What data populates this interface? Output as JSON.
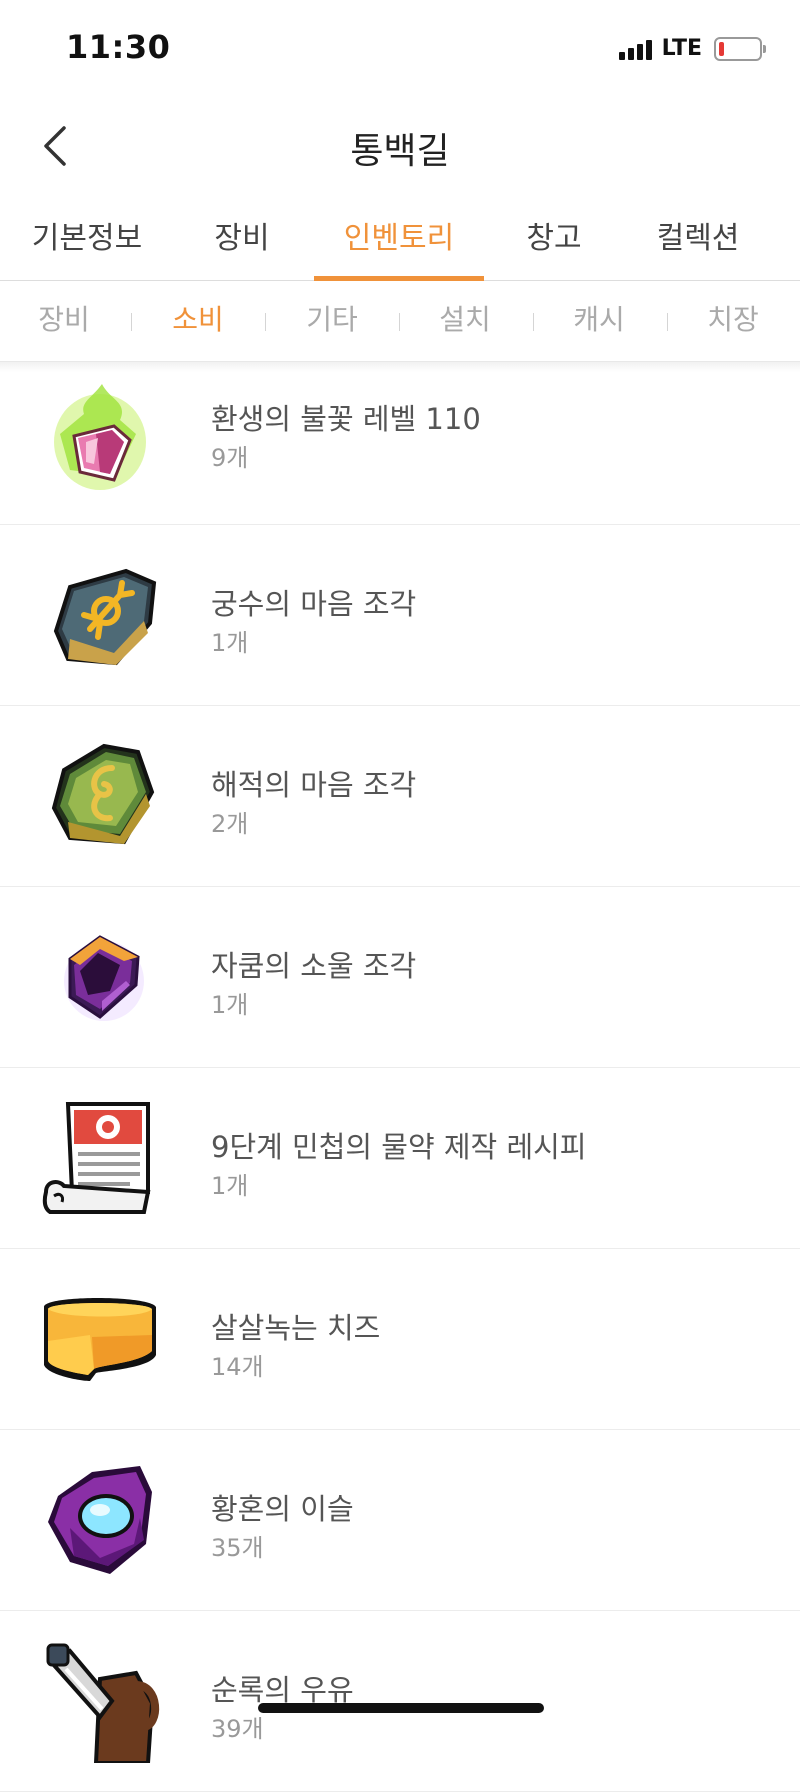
{
  "status_bar": {
    "time": "11:30",
    "network": "LTE"
  },
  "header": {
    "title": "통백길"
  },
  "main_tabs": [
    {
      "label": "기본정보"
    },
    {
      "label": "장비"
    },
    {
      "label": "인벤토리"
    },
    {
      "label": "창고"
    },
    {
      "label": "컬렉션"
    }
  ],
  "active_main_tab": "인벤토리",
  "sub_tabs": [
    {
      "label": "장비"
    },
    {
      "label": "소비"
    },
    {
      "label": "기타"
    },
    {
      "label": "설치"
    },
    {
      "label": "캐시"
    },
    {
      "label": "치장"
    }
  ],
  "active_sub_tab": "소비",
  "colors": {
    "accent": "#f0923a",
    "text": "#555555",
    "muted": "#999999"
  },
  "items": [
    {
      "name": "환생의 불꽃 레벨 110",
      "count": "9개",
      "icon": "rebirth-flame-icon"
    },
    {
      "name": "궁수의 마음 조각",
      "count": "1개",
      "icon": "bowman-heart-fragment-icon"
    },
    {
      "name": "해적의 마음 조각",
      "count": "2개",
      "icon": "pirate-heart-fragment-icon"
    },
    {
      "name": "자쿰의 소울 조각",
      "count": "1개",
      "icon": "zakum-soul-shard-icon"
    },
    {
      "name": "9단계 민첩의 물약 제작 레시피",
      "count": "1개",
      "icon": "recipe-scroll-icon"
    },
    {
      "name": "살살녹는 치즈",
      "count": "14개",
      "icon": "cheese-icon"
    },
    {
      "name": "황혼의 이슬",
      "count": "35개",
      "icon": "twilight-dew-icon"
    },
    {
      "name": "순록의 우유",
      "count": "39개",
      "icon": "reindeer-milk-icon"
    }
  ]
}
